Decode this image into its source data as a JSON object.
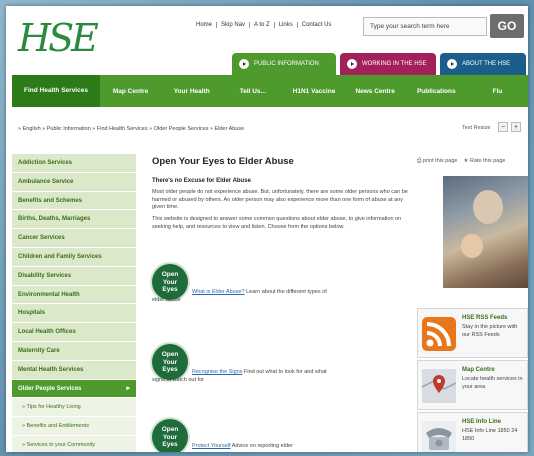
{
  "header": {
    "logo_text": "HSE",
    "top_links": [
      "Home",
      "Skip Nav",
      "A to Z",
      "Links",
      "Contact Us"
    ],
    "search_placeholder": "Type your search term here",
    "go_label": "GO",
    "section_tabs": [
      {
        "label": "PUBLIC INFORMATION",
        "color": "#4e9a2c"
      },
      {
        "label": "WORKING IN THE HSE",
        "color": "#a3215a"
      },
      {
        "label": "ABOUT THE HSE",
        "color": "#1c5e8a"
      }
    ]
  },
  "nav": [
    "Find Health Services",
    "Map Centre",
    "Your Health",
    "Tell Us...",
    "H1N1 Vaccine",
    "News Centre",
    "Publications",
    "Flu"
  ],
  "breadcrumb": "» English » Public Information » Find Health Services » Older People Services » Elder Abuse",
  "text_resize": {
    "label": "Text Resize",
    "minus": "−",
    "plus": "+"
  },
  "sidebar": {
    "items": [
      "Addiction Services",
      "Ambulance Service",
      "Benefits and Schemes",
      "Births, Deaths, Marriages",
      "Cancer Services",
      "Children and Family Services",
      "Disability Services",
      "Environmental Health",
      "Hospitals",
      "Local Health Offices",
      "Maternity Care",
      "Mental Health Services",
      "Older People Services"
    ],
    "subitems": [
      "» Tips for Healthy Living",
      "» Benefits and Entitlements",
      "» Services in your Community"
    ]
  },
  "main": {
    "title": "Open Your Eyes to Elder Abuse",
    "subtitle": "There's no Excuse for Elder Abuse",
    "para1": "Most older people do not experience abuse. But, unfortunately, there are some older persons who can be harmed or abused by others. An older person may also experience more than one form of abuse at any given time.",
    "para2": "This website is designed to answer some common questions about elder abuse, to give information on seeking help, and resources to view and listen. Choose from the options below.",
    "bubble_text": [
      "Open",
      "Your",
      "Eyes"
    ],
    "entries": [
      {
        "link": "What is Elder Abuse?",
        "text": "Learn about the different types of elder abuse"
      },
      {
        "link": "Recognise the Signs",
        "text": "Find out what to look for and what signs to watch out for"
      },
      {
        "link": "Protect Yourself",
        "text": "Advice on reporting elder"
      }
    ]
  },
  "right": {
    "print_label": "print this page",
    "rate_label": "Rate this page",
    "cards": [
      {
        "title": "HSE RSS Feeds",
        "text": "Stay in the picture with our RSS Feeds"
      },
      {
        "title": "Map Centre",
        "text": "Locate health services in your area"
      },
      {
        "title": "HSE Info Line",
        "text": "HSE Info Line 1850 24 1850"
      }
    ]
  }
}
